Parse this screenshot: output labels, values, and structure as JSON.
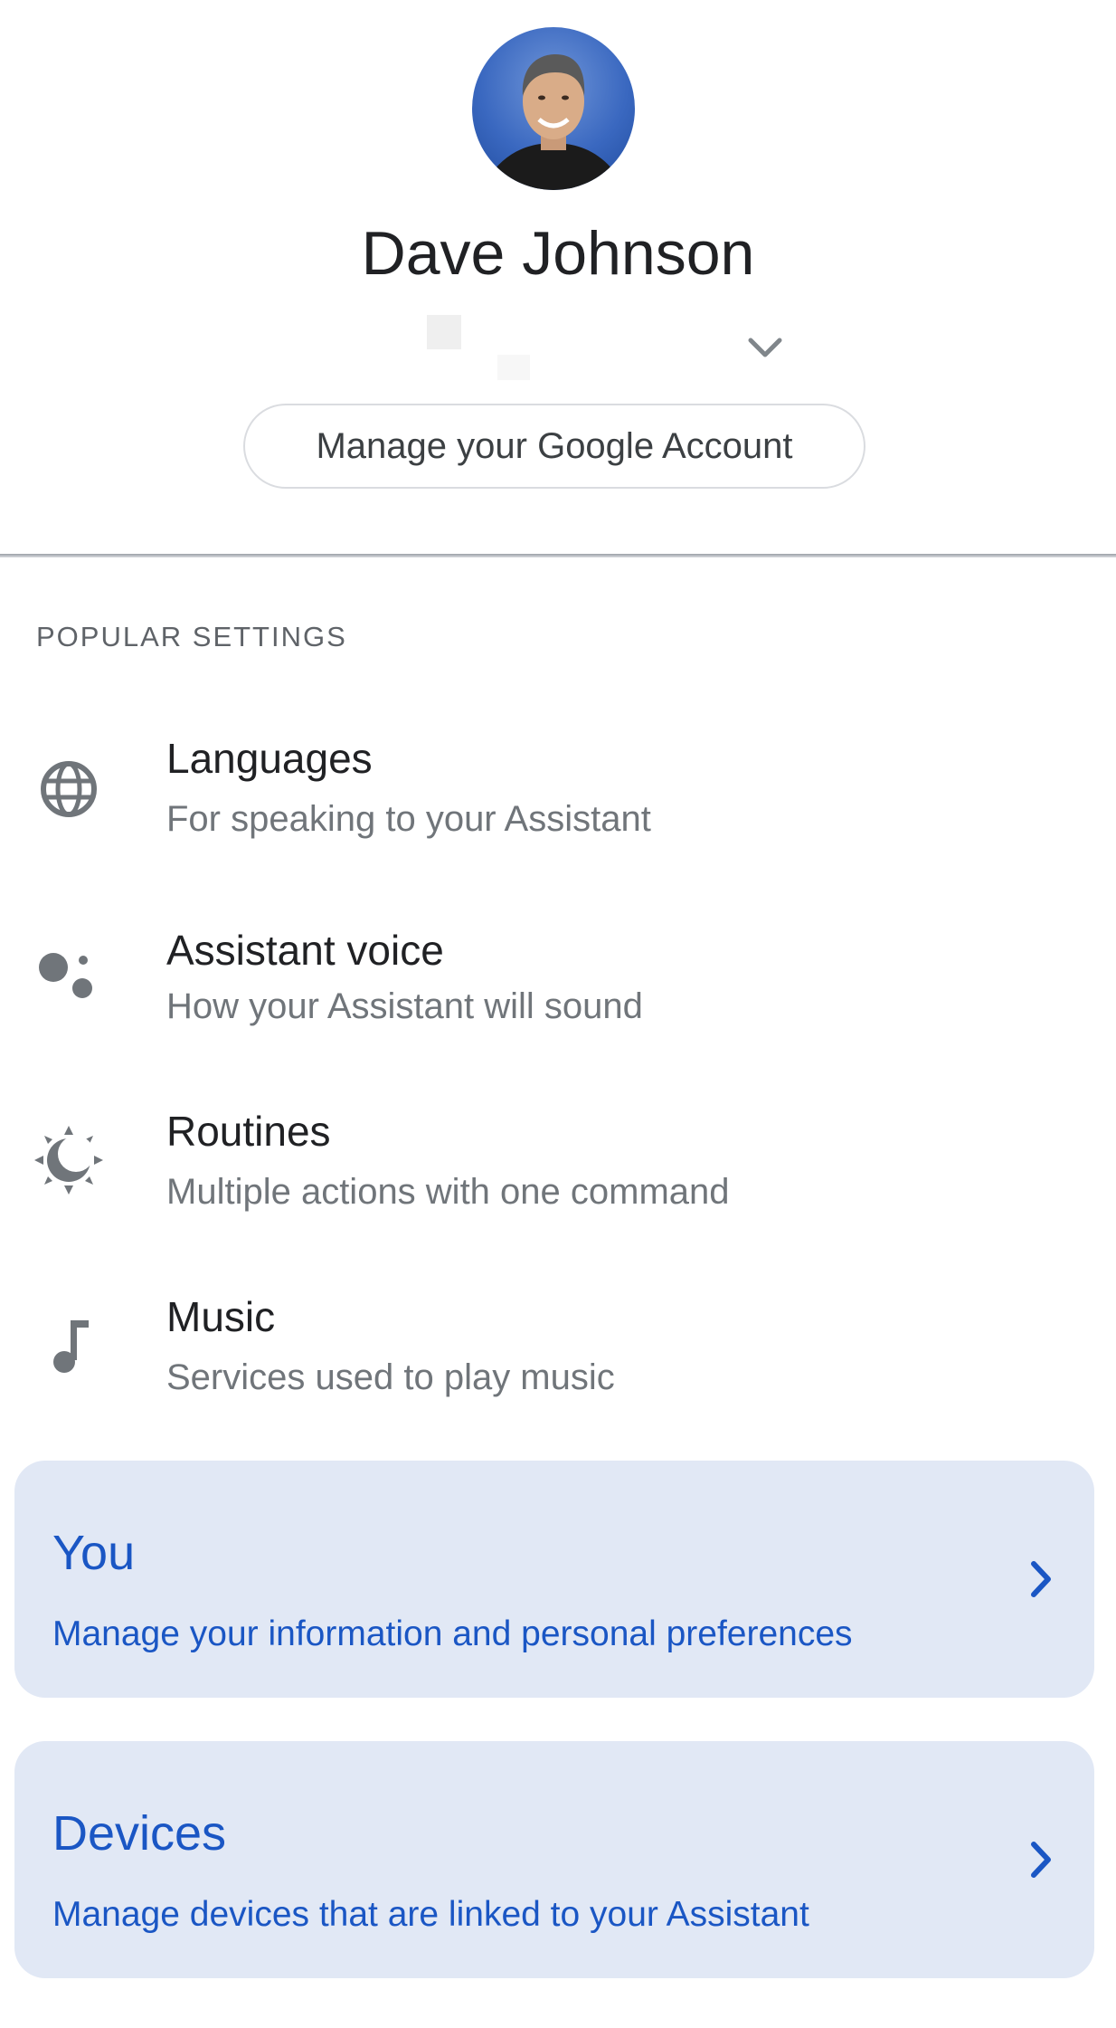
{
  "profile": {
    "name": "Dave Johnson",
    "manage_account_label": "Manage your Google Account"
  },
  "popular_settings": {
    "section_title": "POPULAR SETTINGS",
    "items": [
      {
        "title": "Languages",
        "subtitle": "For speaking to your Assistant",
        "icon": "globe-icon"
      },
      {
        "title": "Assistant voice",
        "subtitle": "How your Assistant will sound",
        "icon": "assistant-dots-icon"
      },
      {
        "title": "Routines",
        "subtitle": "Multiple actions with one command",
        "icon": "sun-moon-icon"
      },
      {
        "title": "Music",
        "subtitle": "Services used to play music",
        "icon": "music-note-icon"
      }
    ]
  },
  "cards": [
    {
      "title": "You",
      "subtitle": "Manage your information and personal preferences",
      "icon": "chevron-right-icon"
    },
    {
      "title": "Devices",
      "subtitle": "Manage devices that are linked to your Assistant",
      "icon": "chevron-right-icon"
    }
  ],
  "colors": {
    "card_background": "#e1e8f5",
    "card_text": "#1a56c4",
    "icon_gray": "#70757a",
    "secondary_text": "#70757a"
  }
}
